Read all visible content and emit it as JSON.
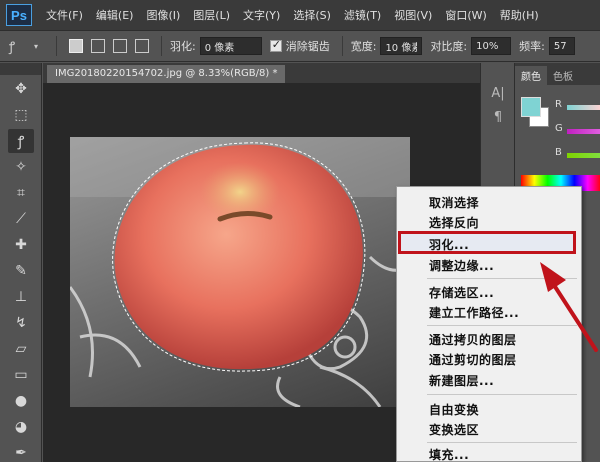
{
  "menubar": {
    "logo": "Ps",
    "items": [
      "文件(F)",
      "编辑(E)",
      "图像(I)",
      "图层(L)",
      "文字(Y)",
      "选择(S)",
      "滤镜(T)",
      "视图(V)",
      "窗口(W)",
      "帮助(H)"
    ]
  },
  "options": {
    "feather_label": "羽化:",
    "feather_value": "0 像素",
    "antialias_label": "消除锯齿",
    "width_label": "宽度:",
    "width_value": "10 像素",
    "contrast_label": "对比度:",
    "contrast_value": "10%",
    "frequency_label": "频率:",
    "frequency_value": "57"
  },
  "document": {
    "tab_title": "IMG20180220154702.jpg @ 8.33%(RGB/8) *",
    "close_glyph": "×"
  },
  "color_panel": {
    "tab_color": "颜色",
    "tab_swatches": "色板",
    "channel_r": "R",
    "channel_g": "G",
    "channel_b": "B",
    "fg_color": "#7fd3d3"
  },
  "context_menu": {
    "items": [
      "取消选择",
      "选择反向",
      "羽化...",
      "调整边缘...",
      "存储选区...",
      "建立工作路径...",
      "通过拷贝的图层",
      "通过剪切的图层",
      "新建图层...",
      "自由变换",
      "变换选区",
      "填充..."
    ],
    "highlighted_index": 2,
    "highlight_color": "#c0131b"
  },
  "annotation": {
    "arrow_color": "#c0131b"
  }
}
